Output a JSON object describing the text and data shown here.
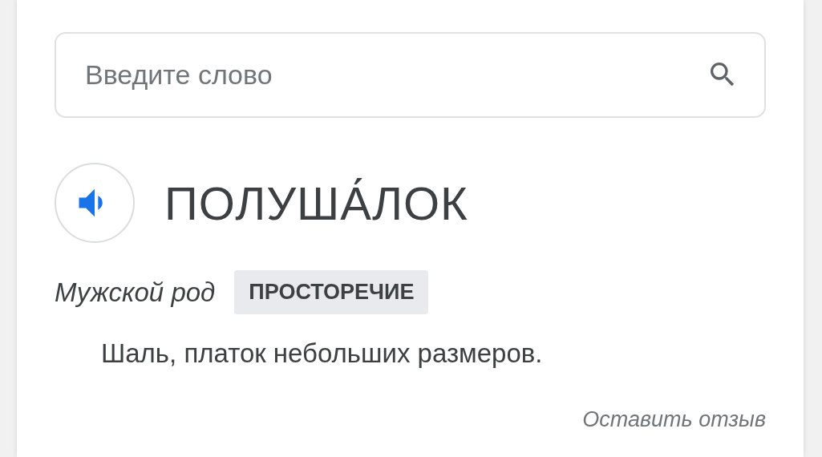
{
  "search": {
    "placeholder": "Введите слово"
  },
  "entry": {
    "word": "ПОЛУША́ЛОК",
    "gender": "Мужской род",
    "tag": "ПРОСТОРЕЧИЕ",
    "definition": "Шаль, платок небольших размеров."
  },
  "feedback": "Оставить отзыв"
}
